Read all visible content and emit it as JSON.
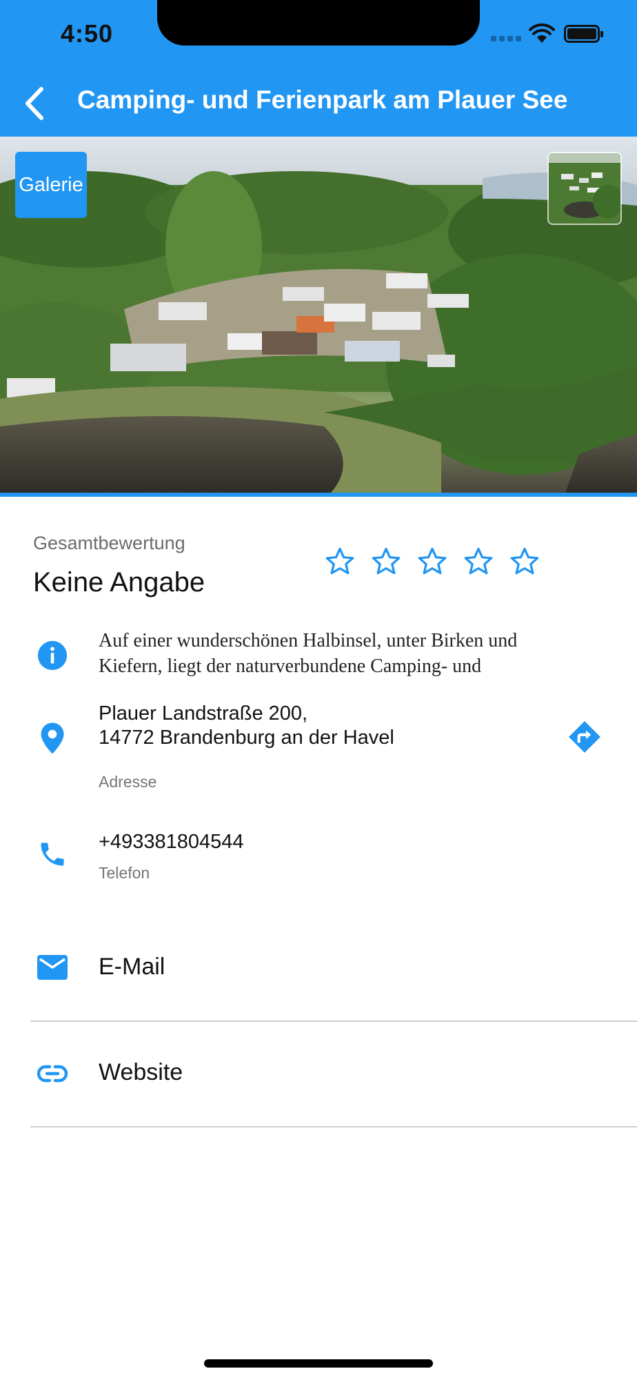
{
  "status_bar": {
    "time": "4:50"
  },
  "app_bar": {
    "title": "Camping- und Ferienpark am Plauer See"
  },
  "gallery": {
    "button_label": "Galerie"
  },
  "rating": {
    "label": "Gesamtbewertung",
    "value": "Keine Angabe",
    "stars_filled": 0,
    "stars_total": 5
  },
  "description": {
    "text": "Auf einer wunderschönen Halbinsel, unter Birken und Kiefern, liegt der naturverbundene Camping- und"
  },
  "address": {
    "line1": "Plauer Landstraße 200,",
    "line2": "14772 Brandenburg an der Havel",
    "label": "Adresse"
  },
  "phone": {
    "number": "+493381804544",
    "label": "Telefon"
  },
  "links": {
    "email_label": "E-Mail",
    "website_label": "Website"
  },
  "colors": {
    "accent": "#2196F3",
    "divider": "#cfcfcf"
  }
}
